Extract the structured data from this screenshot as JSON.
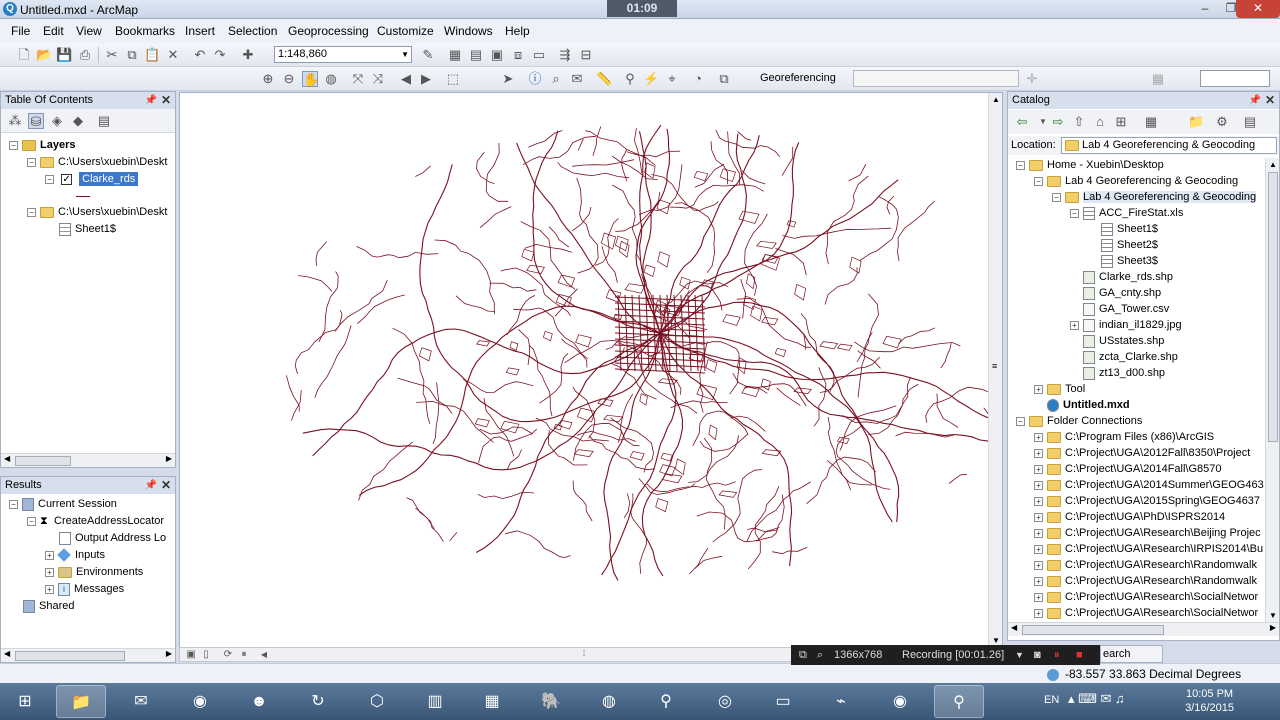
{
  "window": {
    "title": "Untitled.mxd - ArcMap",
    "timer": "01:09"
  },
  "menu": [
    "File",
    "Edit",
    "View",
    "Bookmarks",
    "Insert",
    "Selection",
    "Geoprocessing",
    "Customize",
    "Windows",
    "Help"
  ],
  "toolbar": {
    "scale": "1:148,860",
    "georeferencing_label": "Georeferencing"
  },
  "toc": {
    "title": "Table Of Contents",
    "layers_label": "Layers",
    "group1_path": "C:\\Users\\xuebin\\Deskt",
    "layer_name": "Clarke_rds",
    "group2_path": "C:\\Users\\xuebin\\Deskt",
    "table_name": "Sheet1$"
  },
  "results": {
    "title": "Results",
    "items": [
      "Current Session",
      "CreateAddressLocator",
      "Output Address Lo",
      "Inputs",
      "Environments",
      "Messages",
      "Shared"
    ]
  },
  "catalog": {
    "title": "Catalog",
    "location_label": "Location:",
    "location_value": "Lab 4 Georeferencing & Geocoding",
    "items": [
      "Home - Xuebin\\Desktop",
      "Lab 4 Georeferencing & Geocoding",
      "Lab 4 Georeferencing & Geocoding",
      "ACC_FireStat.xls",
      "Sheet1$",
      "Sheet2$",
      "Sheet3$",
      "Clarke_rds.shp",
      "GA_cnty.shp",
      "GA_Tower.csv",
      "indian_il1829.jpg",
      "USstates.shp",
      "zcta_Clarke.shp",
      "zt13_d00.shp",
      "Tool",
      "Untitled.mxd",
      "Folder Connections",
      "C:\\Program Files (x86)\\ArcGIS",
      "C:\\Project\\UGA\\2012Fall\\8350\\Project",
      "C:\\Project\\UGA\\2014Fall\\G8570",
      "C:\\Project\\UGA\\2014Summer\\GEOG463",
      "C:\\Project\\UGA\\2015Spring\\GEOG4637",
      "C:\\Project\\UGA\\PhD\\ISPRS2014",
      "C:\\Project\\UGA\\Research\\Beijing Projec",
      "C:\\Project\\UGA\\Research\\IRPIS2014\\Bu",
      "C:\\Project\\UGA\\Research\\Randomwalk",
      "C:\\Project\\UGA\\Research\\Randomwalk",
      "C:\\Project\\UGA\\Research\\SocialNetwor",
      "C:\\Project\\UGA\\Research\\SocialNetwor"
    ],
    "search_tab": "earch"
  },
  "recording": {
    "resolution": "1366x768",
    "status": "Recording [00:01.26]"
  },
  "status": {
    "coordinates": "-83.557  33.863 Decimal Degrees"
  },
  "taskbar": {
    "lang": "EN",
    "time": "10:05 PM",
    "date": "3/16/2015"
  },
  "colors": {
    "roads": "#7a1020",
    "panel_header": "#d7dfec",
    "taskbar": "#3a5677"
  },
  "map": {
    "layer_shown": "Clarke_rds",
    "feature": "road network"
  }
}
